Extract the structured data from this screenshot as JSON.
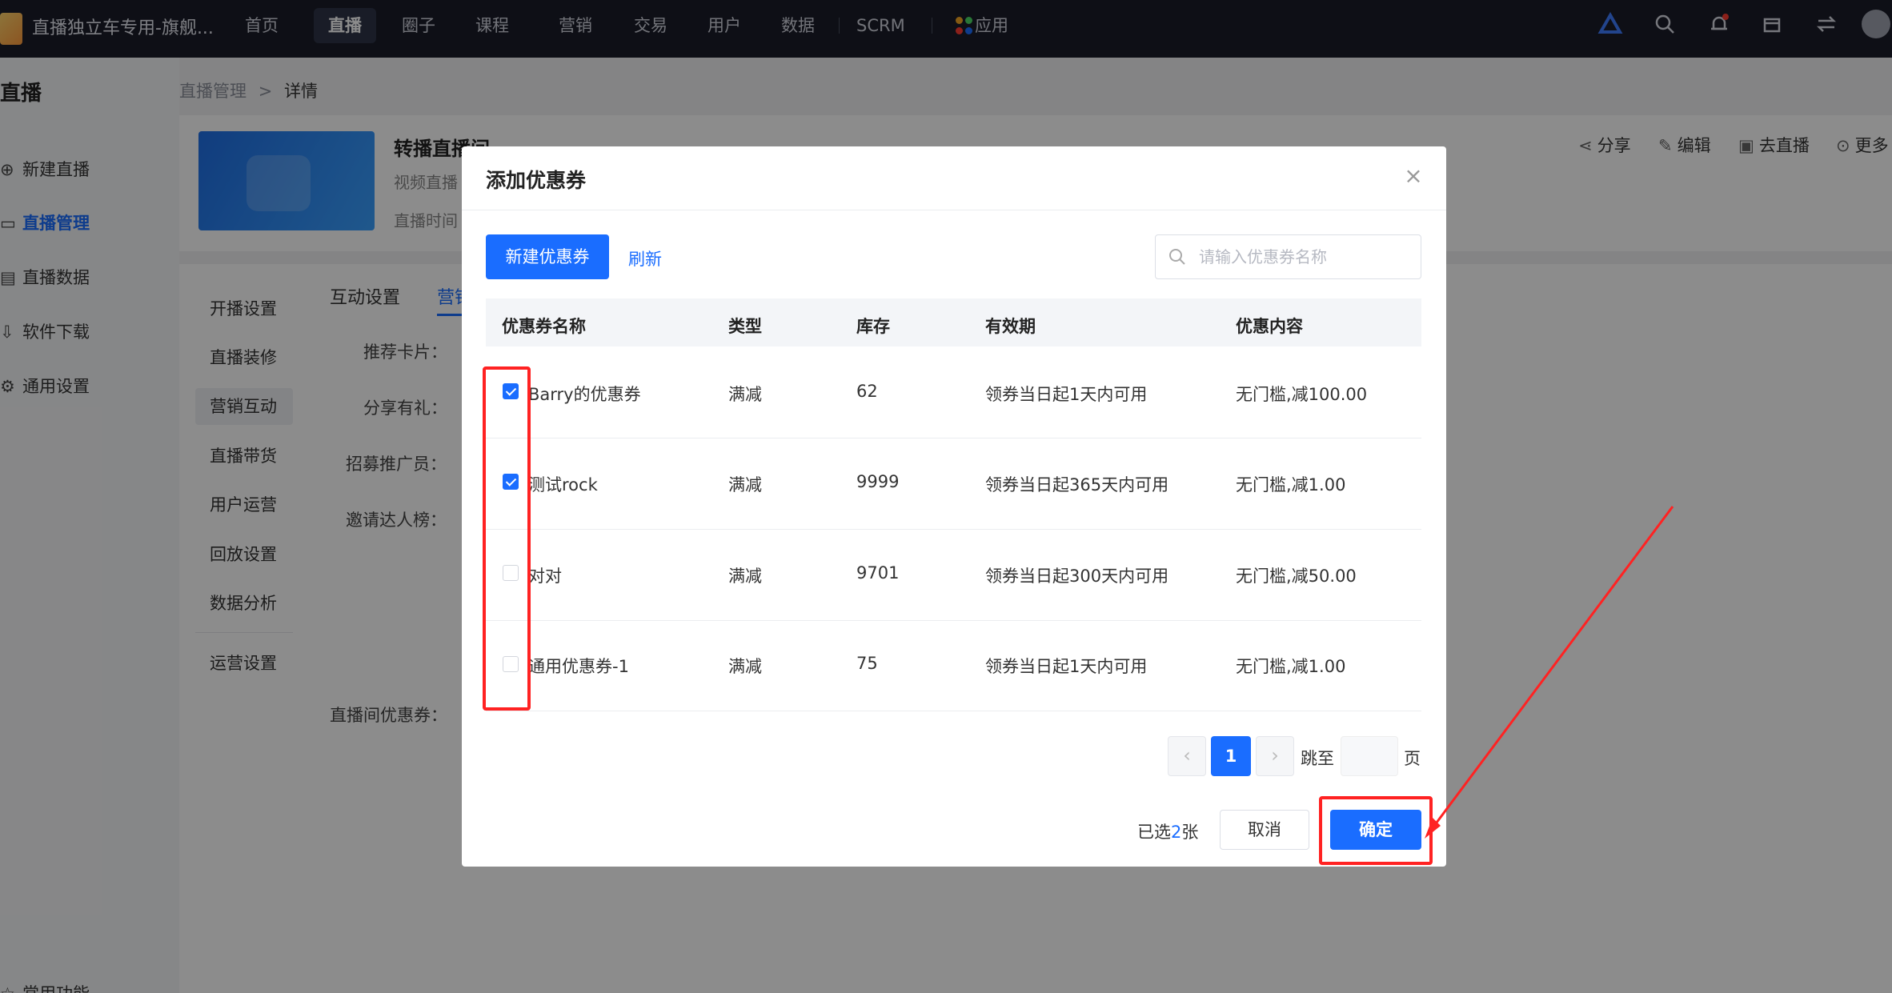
{
  "topbar": {
    "store_name": "直播独立车专用-旗舰...",
    "nav": [
      "首页",
      "直播",
      "圈子",
      "课程",
      "营销",
      "交易",
      "用户",
      "数据",
      "SCRM"
    ],
    "apps_label": "应用"
  },
  "sidebar": {
    "title": "直播",
    "items": [
      "新建直播",
      "直播管理",
      "直播数据",
      "软件下载",
      "通用设置"
    ],
    "bottom_item": "常用功能"
  },
  "breadcrumb": {
    "parent": "直播管理",
    "separator": ">",
    "current": "详情"
  },
  "live": {
    "title": "转播直播间",
    "type_text": "视频直播",
    "time_text": "直播时间"
  },
  "actions": [
    "分享",
    "编辑",
    "去直播",
    "更多"
  ],
  "subnav": [
    "开播设置",
    "直播装修",
    "营销互动",
    "直播带货",
    "用户运营",
    "回放设置",
    "数据分析",
    "运营设置"
  ],
  "tabs": [
    "互动设置",
    "营销"
  ],
  "form_labels": [
    "推荐卡片：",
    "分享有礼：",
    "招募推广员：",
    "邀请达人榜：",
    "直播间优惠券："
  ],
  "modal": {
    "title": "添加优惠券",
    "new_button": "新建优惠券",
    "refresh": "刷新",
    "search_placeholder": "请输入优惠券名称",
    "columns": [
      "优惠券名称",
      "类型",
      "库存",
      "有效期",
      "优惠内容"
    ],
    "rows": [
      {
        "checked": true,
        "name": "Barry的优惠券",
        "type": "满减",
        "stock": "62",
        "validity": "领券当日起1天内可用",
        "content": "无门槛,减100.00"
      },
      {
        "checked": true,
        "name": "测试rock",
        "type": "满减",
        "stock": "9999",
        "validity": "领券当日起365天内可用",
        "content": "无门槛,减1.00"
      },
      {
        "checked": false,
        "name": "对对",
        "type": "满减",
        "stock": "9701",
        "validity": "领券当日起300天内可用",
        "content": "无门槛,减50.00"
      },
      {
        "checked": false,
        "name": "通用优惠券-1",
        "type": "满减",
        "stock": "75",
        "validity": "领券当日起1天内可用",
        "content": "无门槛,减1.00"
      }
    ],
    "pagination": {
      "current_page": "1",
      "jump_label": "跳至",
      "page_unit": "页"
    },
    "selected": {
      "prefix": "已选",
      "count": "2",
      "suffix": "张"
    },
    "cancel": "取消",
    "confirm": "确定"
  },
  "colors": {
    "primary": "#1a6dff",
    "annotation": "#ff2222",
    "topbar": "#1a1d29"
  }
}
